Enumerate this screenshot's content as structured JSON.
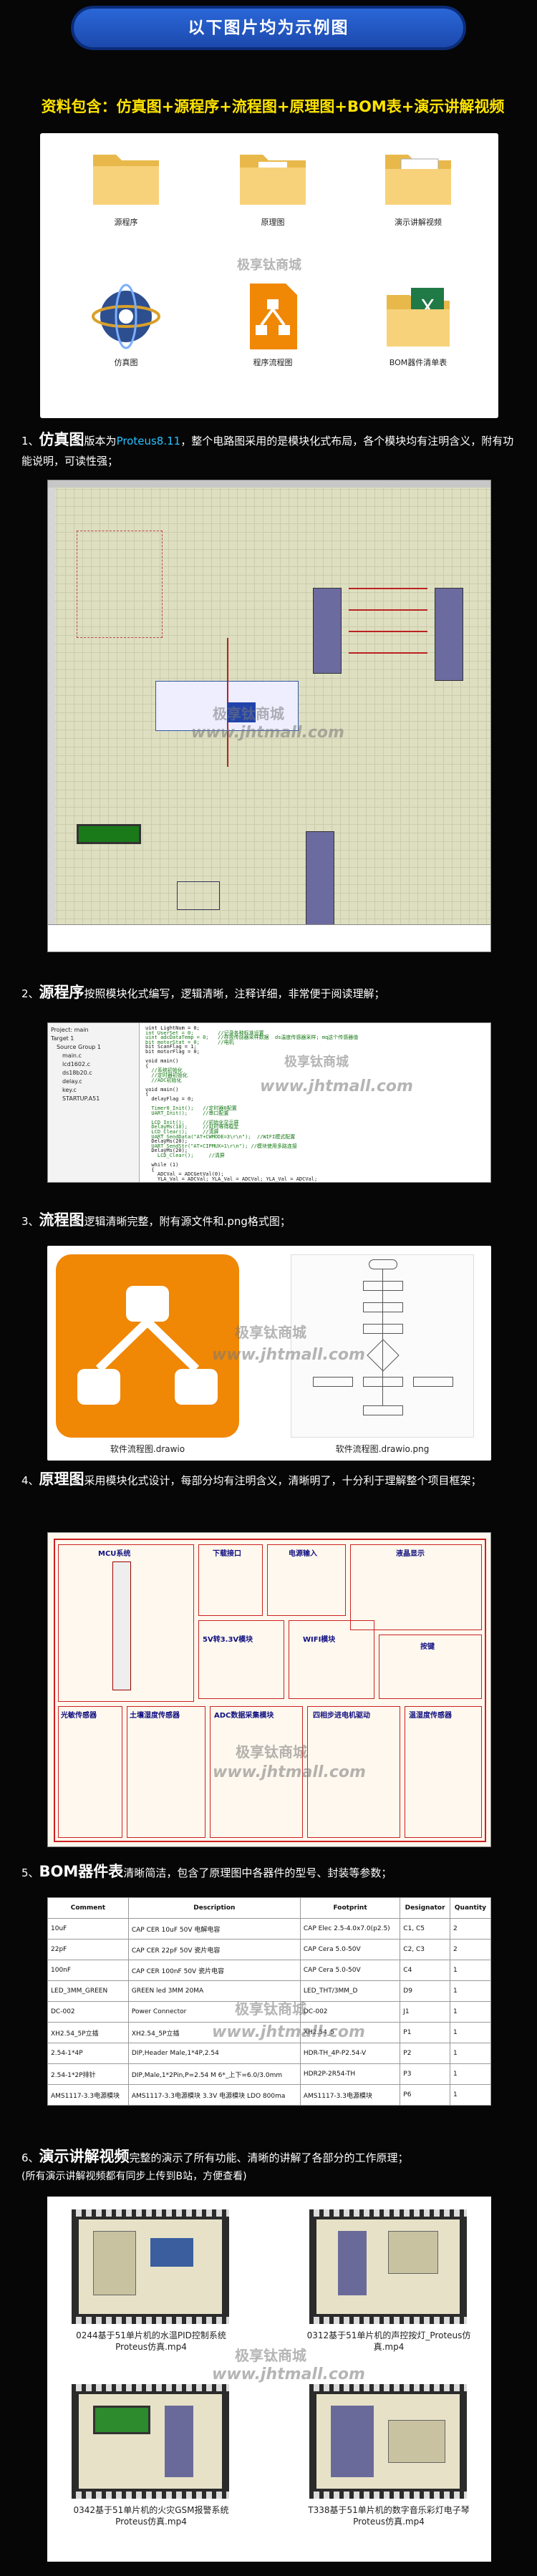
{
  "banner": "以下图片均为示例图",
  "resources_line": "资料包含：仿真图+源程序+流程图+原理图+BOM表+演示讲解视频",
  "files": [
    {
      "label": "源程序",
      "icon": "folder-icon"
    },
    {
      "label": "原理图",
      "icon": "folder-icon"
    },
    {
      "label": "演示讲解视频",
      "icon": "folder-icon"
    },
    {
      "label": "仿真图",
      "icon": "proteus-icon"
    },
    {
      "label": "程序流程图",
      "icon": "drawio-file-icon"
    },
    {
      "label": "BOM器件清单表",
      "icon": "excel-icon"
    }
  ],
  "watermark_cn": "极享钛商城",
  "watermark_url": "www.jhtmall.com",
  "sec1": {
    "num": "1、",
    "title": "仿真图",
    "pre": "版本为",
    "highlight": "Proteus8.11",
    "rest": "，整个电路图采用的是模块化式布局，各个模块均有注明含义，附有功能说明，可读性强；"
  },
  "sec2": {
    "num": "2、",
    "title": "源程序",
    "rest": "按照模块化式编写，逻辑清晰，注释详细，非常便于阅读理解；"
  },
  "sec3": {
    "num": "3、",
    "title": "流程图",
    "rest": "逻辑清晰完整，附有源文件和.png格式图；"
  },
  "sec4": {
    "num": "4、",
    "title": "原理图",
    "rest": "采用模块化式设计，每部分均有注明含义，清晰明了，十分利于理解整个项目框架；"
  },
  "sec5": {
    "num": "5、",
    "title": "BOM器件表",
    "rest": "清晰简洁，包含了原理图中各器件的型号、封装等参数；"
  },
  "sec6": {
    "num": "6、",
    "title": "演示讲解视频",
    "rest": "完整的演示了所有功能、清晰的讲解了各部分的工作原理；",
    "note": "(所有演示讲解视频都有同步上传到B站，方便查看)"
  },
  "flow": {
    "left_caption": "软件流程图.drawio",
    "right_caption": "软件流程图.drawio.png"
  },
  "schematic_labels": [
    "MCU系统",
    "下载接口",
    "电源输入",
    "液晶显示",
    "5V转3.3V模块",
    "WIFI模块",
    "按键",
    "光敏传感器",
    "土壤湿度传感器",
    "ADC数据采集模块",
    "四相步进电机驱动",
    "温湿度传感器"
  ],
  "bom": {
    "headers": [
      "Comment",
      "Description",
      "Footprint",
      "Designator",
      "Quantity"
    ],
    "rows": [
      [
        "10uF",
        "CAP CER 10uF 50V 电解电容",
        "CAP Elec 2.5-4.0x7.0(p2.5)",
        "C1, C5",
        "2"
      ],
      [
        "22pF",
        "CAP CER 22pF 50V 瓷片电容",
        "CAP Cera 5.0-50V",
        "C2, C3",
        "2"
      ],
      [
        "100nF",
        "CAP CER 100nF 50V 瓷片电容",
        "CAP Cera 5.0-50V",
        "C4",
        "1"
      ],
      [
        "LED_3MM_GREEN",
        "GREEN led 3MM 20MA",
        "LED_THT/3MM_D",
        "D9",
        "1"
      ],
      [
        "DC-002",
        "Power Connector",
        "DC-002",
        "J1",
        "1"
      ],
      [
        "XH2.54_5P立插",
        "XH2.54_5P立插",
        "XH2.54_5",
        "P1",
        "1"
      ],
      [
        "2.54-1*4P",
        "DIP,Header Male,1*4P,2.54",
        "HDR-TH_4P-P2.54-V",
        "P2",
        "1"
      ],
      [
        "2.54-1*2P排针",
        "DIP,Male,1*2Pin,P=2.54 M 6*_上下=6.0/3.0mm",
        "HDR2P-2R54-TH",
        "P3",
        "1"
      ],
      [
        "AMS1117-3.3电源模块",
        "AMS1117-3.3电源模块 3.3V 电源模块 LDO 800ma",
        "AMS1117-3.3电源模块",
        "P6",
        "1"
      ]
    ]
  },
  "videos": [
    "0244基于51单片机的水温PID控制系统Proteus仿真.mp4",
    "0312基于51单片机的声控按灯_Proteus仿真.mp4",
    "0342基于51单片机的火灾GSM报警系统Proteus仿真.mp4",
    "T338基于51单片机的数字音乐彩灯电子琴Proteus仿真.mp4"
  ],
  "code": {
    "tree": [
      "Project: main",
      "Target 1",
      "Source Group 1",
      "main.c",
      "lcd1602.c",
      "ds18b20.c",
      "delay.c",
      "key.c",
      "STARTUP.A51"
    ],
    "lines": [
      "uint LightNum = 0;",
      "int UserSet = 0;        //记录各种标准设置",
      "uint adcDataTemp = 0;   //存放传感器采样数据  ds温度传感器采样; mq这个传感器值",
      "bit motorStat = 0;      //电机",
      "bit ScanFlag = 1;",
      "bit motorFlag = 0;",
      "",
      "void main()",
      "{",
      "  //系统初始化",
      "  //定时器初始化",
      "  //ADC初始化",
      "",
      "void main()",
      "{",
      "  delayFlag = 0;",
      "",
      "  Timer0_Init();   //定时器0配置",
      "  UART_Init();     //串口配置",
      "",
      "  LCD_Init();      //初始化显示屏",
      "  DelayMs(10);     //延时等待稳定",
      "  LCD_Clear();     //清屏",
      "  UART_SendData(\"AT+CWMODE=3\\r\\n\");  //WIFI模式配置",
      "  DelayMs(20);",
      "  UART_SendStr(\"AT+CIPMUX=1\\r\\n\"); //模块使用多路连接",
      "  DelayMs(20);",
      "    LCD_Clear();     //清屏",
      "",
      "  while (1)",
      "  {",
      "    ADCVal = ADCGetVal(0);",
      "    YLA_Val = ADCVal; YLA_Val = ADCVal; YLA_Val = ADCVal;"
    ]
  }
}
